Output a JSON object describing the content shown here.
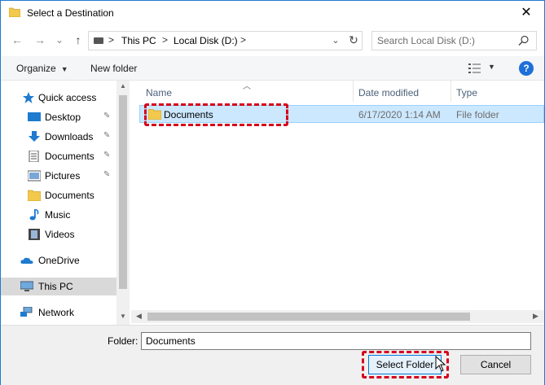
{
  "window": {
    "title": "Select a Destination",
    "close_glyph": "✕"
  },
  "nav": {
    "back_glyph": "←",
    "forward_glyph": "→",
    "recent_glyph": "⌄",
    "up_glyph": "↑",
    "breadcrumb": [
      "This PC",
      "Local Disk (D:)"
    ],
    "chevron": ">",
    "search_placeholder": "Search Local Disk (D:)"
  },
  "toolbar": {
    "organize_label": "Organize",
    "new_folder_label": "New folder",
    "help_glyph": "?"
  },
  "sidebar": {
    "items": [
      {
        "label": "Quick access",
        "icon": "star-icon",
        "pinned": false
      },
      {
        "label": "Desktop",
        "icon": "desktop-icon",
        "pinned": true
      },
      {
        "label": "Downloads",
        "icon": "download-icon",
        "pinned": true
      },
      {
        "label": "Documents",
        "icon": "documents-icon",
        "pinned": true
      },
      {
        "label": "Pictures",
        "icon": "pictures-icon",
        "pinned": true
      },
      {
        "label": "Documents",
        "icon": "folder-icon",
        "pinned": false
      },
      {
        "label": "Music",
        "icon": "music-icon",
        "pinned": false
      },
      {
        "label": "Videos",
        "icon": "videos-icon",
        "pinned": false
      },
      {
        "label": "OneDrive",
        "icon": "onedrive-icon",
        "pinned": false
      },
      {
        "label": "This PC",
        "icon": "computer-icon",
        "pinned": false,
        "selected": true
      },
      {
        "label": "Network",
        "icon": "network-icon",
        "pinned": false
      }
    ],
    "pin_glyph": "📌"
  },
  "columns": {
    "name": "Name",
    "date_modified": "Date modified",
    "type": "Type"
  },
  "files": [
    {
      "name": "Documents",
      "date_modified": "6/17/2020 1:14 AM",
      "type": "File folder",
      "selected": true
    }
  ],
  "footer": {
    "folder_label": "Folder:",
    "folder_value": "Documents",
    "select_button": "Select Folder",
    "cancel_button": "Cancel"
  },
  "colors": {
    "accent": "#0078d7",
    "selection": "#cce8ff",
    "highlight": "#d6001c",
    "folder": "#f2c94c"
  }
}
